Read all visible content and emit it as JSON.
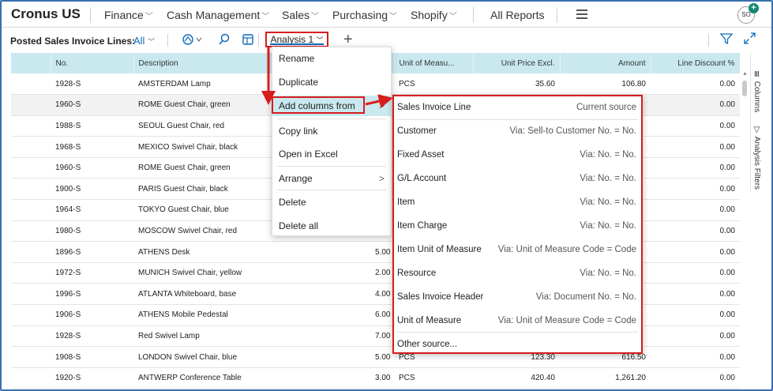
{
  "nav": {
    "company": "Cronus US",
    "items": [
      {
        "label": "Finance"
      },
      {
        "label": "Cash Management"
      },
      {
        "label": "Sales"
      },
      {
        "label": "Purchasing"
      },
      {
        "label": "Shopify"
      }
    ],
    "all_reports": "All Reports",
    "avatar_initials": "SO",
    "avatar_badge": "+"
  },
  "toolbar": {
    "title": "Posted Sales Invoice Lines:",
    "filter": "All",
    "analysis_tab": "Analysis 1",
    "add": "+"
  },
  "grid": {
    "columns": [
      "No.",
      "Description",
      "Unit of Measu...",
      "Unit Price Excl.",
      "Amount",
      "Line Discount %"
    ],
    "rows": [
      {
        "no": "1928-S",
        "desc": "AMSTERDAM Lamp",
        "qty": "",
        "uom": "PCS",
        "price": "35.60",
        "amount": "106.80",
        "disc": "0.00"
      },
      {
        "no": "1960-S",
        "desc": "ROME Guest Chair, green",
        "qty": "",
        "uom": "",
        "price": "",
        "amount": "",
        "disc": "0.00"
      },
      {
        "no": "1988-S",
        "desc": "SEOUL Guest Chair, red",
        "qty": "",
        "uom": "",
        "price": "",
        "amount": "",
        "disc": "0.00"
      },
      {
        "no": "1968-S",
        "desc": "MEXICO Swivel Chair, black",
        "qty": "",
        "uom": "",
        "price": "",
        "amount": "",
        "disc": "0.00"
      },
      {
        "no": "1960-S",
        "desc": "ROME Guest Chair, green",
        "qty": "",
        "uom": "",
        "price": "",
        "amount": "",
        "disc": "0.00"
      },
      {
        "no": "1900-S",
        "desc": "PARIS Guest Chair, black",
        "qty": "",
        "uom": "",
        "price": "",
        "amount": "",
        "disc": "0.00"
      },
      {
        "no": "1964-S",
        "desc": "TOKYO Guest Chair, blue",
        "qty": "",
        "uom": "",
        "price": "",
        "amount": "",
        "disc": "0.00"
      },
      {
        "no": "1980-S",
        "desc": "MOSCOW Swivel Chair, red",
        "qty": "",
        "uom": "",
        "price": "",
        "amount": "",
        "disc": "0.00"
      },
      {
        "no": "1896-S",
        "desc": "ATHENS Desk",
        "qty": "5.00",
        "uom": "",
        "price": "",
        "amount": "",
        "disc": "0.00"
      },
      {
        "no": "1972-S",
        "desc": "MUNICH Swivel Chair, yellow",
        "qty": "2.00",
        "uom": "",
        "price": "",
        "amount": "",
        "disc": "0.00"
      },
      {
        "no": "1996-S",
        "desc": "ATLANTA Whiteboard, base",
        "qty": "4.00",
        "uom": "",
        "price": "",
        "amount": "",
        "disc": "0.00"
      },
      {
        "no": "1906-S",
        "desc": "ATHENS Mobile Pedestal",
        "qty": "6.00",
        "uom": "",
        "price": "",
        "amount": "",
        "disc": "0.00"
      },
      {
        "no": "1928-S",
        "desc": "Red Swivel Lamp",
        "qty": "7.00",
        "uom": "",
        "price": "",
        "amount": "",
        "disc": "0.00"
      },
      {
        "no": "1908-S",
        "desc": "LONDON Swivel Chair, blue",
        "qty": "5.00",
        "uom": "PCS",
        "price": "123.30",
        "amount": "616.50",
        "disc": "0.00"
      },
      {
        "no": "1920-S",
        "desc": "ANTWERP Conference Table",
        "qty": "3.00",
        "uom": "PCS",
        "price": "420.40",
        "amount": "1,261.20",
        "disc": "0.00"
      }
    ]
  },
  "side_panel": {
    "columns": "Columns",
    "filters": "Analysis Filters"
  },
  "context_menu": {
    "items": [
      "Rename",
      "Duplicate",
      "Add columns from",
      "Copy link",
      "Open in Excel",
      "Arrange",
      "Delete",
      "Delete all"
    ]
  },
  "submenu": {
    "items": [
      {
        "label": "Sales Invoice Line",
        "via": "Current source"
      },
      {
        "label": "Customer",
        "via": "Via: Sell-to Customer No. = No."
      },
      {
        "label": "Fixed Asset",
        "via": "Via: No. = No."
      },
      {
        "label": "G/L Account",
        "via": "Via: No. = No."
      },
      {
        "label": "Item",
        "via": "Via: No. = No."
      },
      {
        "label": "Item Charge",
        "via": "Via: No. = No."
      },
      {
        "label": "Item Unit of Measure",
        "via": "Via: Unit of Measure Code = Code"
      },
      {
        "label": "Resource",
        "via": "Via: No. = No."
      },
      {
        "label": "Sales Invoice Header",
        "via": "Via: Document No. = No."
      },
      {
        "label": "Unit of Measure",
        "via": "Via: Unit of Measure Code = Code"
      }
    ],
    "other": "Other source..."
  },
  "colors": {
    "header_bg": "#c9e9ef",
    "accent": "#0f6cbd",
    "highlight_red": "#d81d1d",
    "frame": "#3a6fb0"
  }
}
